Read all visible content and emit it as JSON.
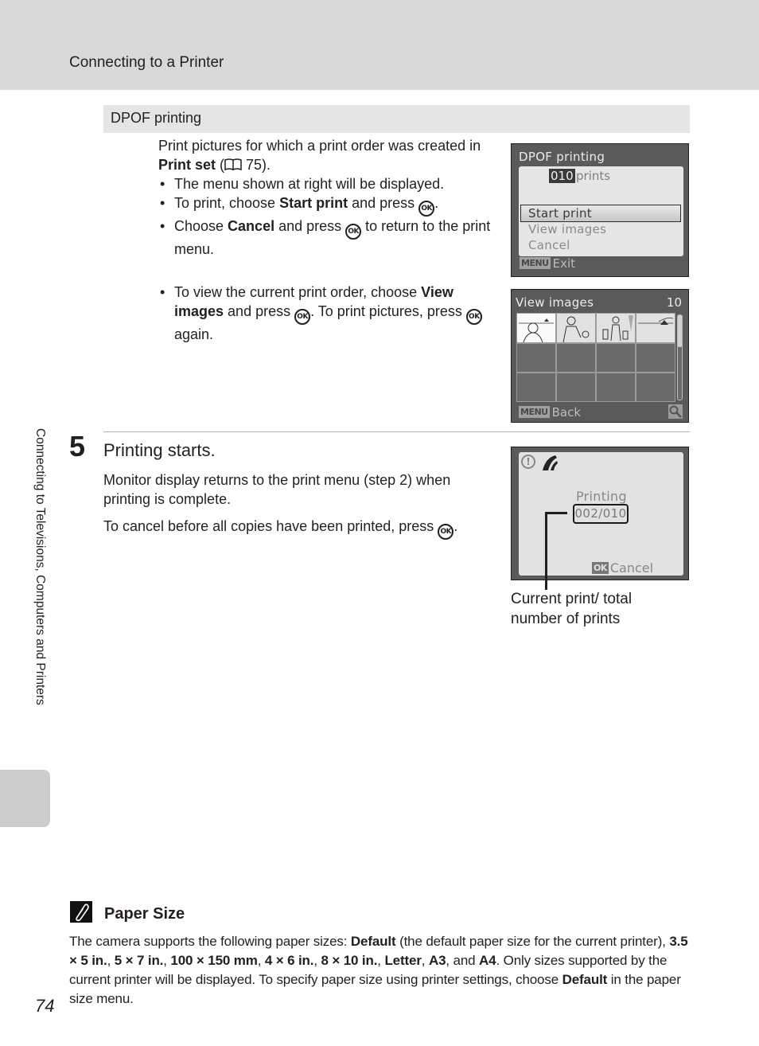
{
  "header": {
    "title": "Connecting to a Printer"
  },
  "section": {
    "label": "DPOF printing"
  },
  "intro": {
    "text_before": "Print pictures for which a print order was created in ",
    "bold": "Print set",
    "text_after_open": " (",
    "ref_icon": "book-icon",
    "ref_page": " 75)."
  },
  "bullets1": [
    {
      "text": "The menu shown at right will be displayed."
    },
    {
      "pre": "To print, choose ",
      "bold": "Start print",
      "post": " and press ",
      "icon": "ok-button-icon",
      "end": "."
    },
    {
      "pre": "Choose ",
      "bold": "Cancel",
      "post": " and press ",
      "icon": "ok-button-icon",
      "end": " to return to the print menu."
    }
  ],
  "bullets2": [
    {
      "pre": "To view the current print order, choose ",
      "bold": "View images",
      "post": " and press ",
      "mid": ". To print pictures, press ",
      "end": " again."
    }
  ],
  "ok_glyph": "OK",
  "screen_dpof": {
    "title": "DPOF printing",
    "count": "010",
    "count_unit": "prints",
    "menu": [
      "Start print",
      "View images",
      "Cancel"
    ],
    "selected_index": 0,
    "footer_key": "MENU",
    "footer_label": "Exit"
  },
  "screen_view": {
    "title": "View images",
    "count": "10",
    "thumbnails_with_images": 4,
    "grid_cells": 12,
    "footer_key": "MENU",
    "footer_label": "Back",
    "zoom_icon": "magnifier-icon"
  },
  "step5": {
    "number": "5",
    "title": "Printing starts.",
    "p1": "Monitor display returns to the print menu (step 2) when printing is complete.",
    "p2_pre": "To cancel before all copies have been printed, press ",
    "p2_end": "."
  },
  "screen_printing": {
    "warn_icon": "warning-icon",
    "printer_icon": "pictbridge-icon",
    "label": "Printing",
    "progress": "002/010",
    "footer_key": "OK",
    "footer_label": "Cancel"
  },
  "callout": {
    "line1": "Current print/ total",
    "line2": "number of prints"
  },
  "side_label": "Connecting to Televisions, Computers and Printers",
  "note": {
    "title": "Paper Size",
    "segments": [
      {
        "t": "The camera supports the following paper sizes: "
      },
      {
        "b": "Default"
      },
      {
        "t": " (the default paper size for the current printer), "
      },
      {
        "b": "3.5 × 5 in."
      },
      {
        "t": ", "
      },
      {
        "b": "5 × 7 in."
      },
      {
        "t": ", "
      },
      {
        "b": "100 × 150 mm"
      },
      {
        "t": ", "
      },
      {
        "b": "4 × 6 in."
      },
      {
        "t": ", "
      },
      {
        "b": "8 × 10 in."
      },
      {
        "t": ", "
      },
      {
        "b": "Letter"
      },
      {
        "t": ", "
      },
      {
        "b": "A3"
      },
      {
        "t": ", and "
      },
      {
        "b": "A4"
      },
      {
        "t": ". Only sizes supported by the current printer will be displayed. To specify paper size using printer settings, choose "
      },
      {
        "b": "Default"
      },
      {
        "t": " in the paper size menu."
      }
    ]
  },
  "page_number": "74"
}
